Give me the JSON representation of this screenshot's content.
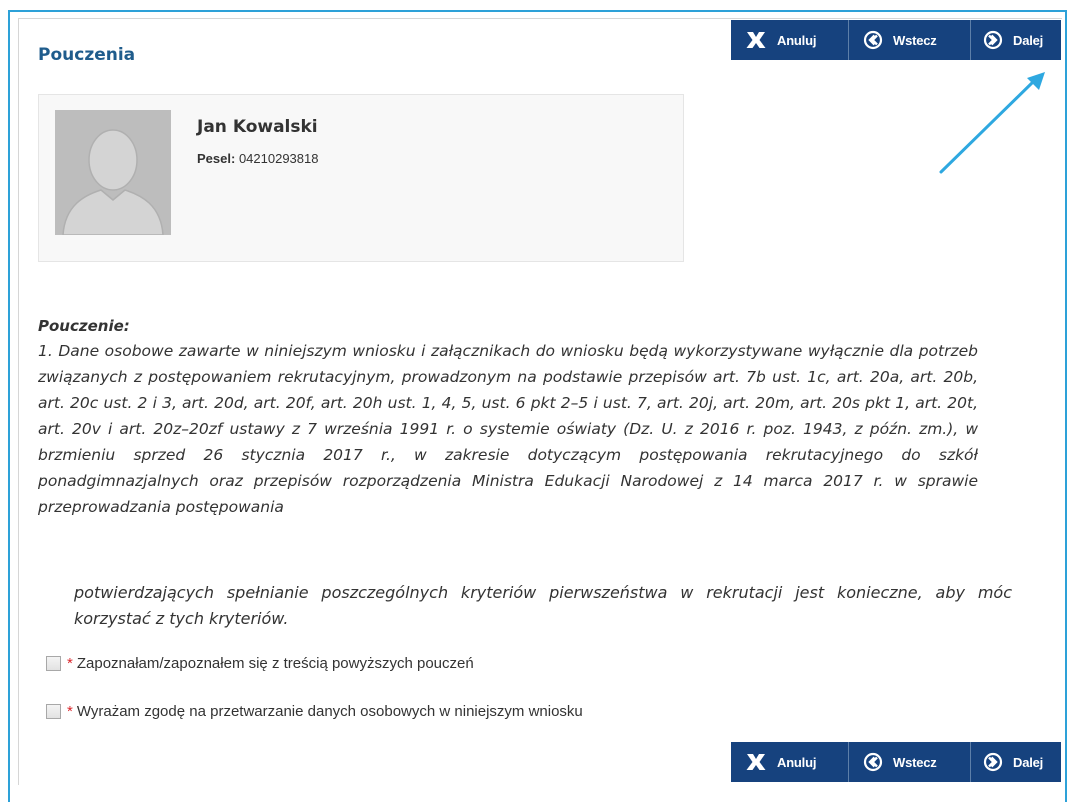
{
  "page": {
    "title": "Pouczenia"
  },
  "buttons": {
    "anuluj": "Anuluj",
    "wstecz": "Wstecz",
    "dalej": "Dalej"
  },
  "profile": {
    "name": "Jan Kowalski",
    "pesel_label": "Pesel:",
    "pesel_value": "04210293818"
  },
  "notice": {
    "heading": "Pouczenie:",
    "body": "1. Dane osobowe zawarte w niniejszym wniosku i załącznikach do wniosku będą wykorzystywane wyłącznie dla potrzeb związanych z postępowaniem rekrutacyjnym, prowadzonym na podstawie przepisów art. 7b ust. 1c, art. 20a, art. 20b, art. 20c ust. 2 i 3, art. 20d, art. 20f, art. 20h ust. 1, 4, 5, ust. 6 pkt 2–5 i ust. 7, art. 20j, art. 20m, art. 20s pkt 1, art. 20t, art. 20v i art. 20z–20zf ustawy z 7 września 1991 r. o systemie oświaty (Dz. U. z 2016 r. poz. 1943, z późn. zm.), w brzmieniu sprzed 26 stycznia 2017 r., w zakresie dotyczącym postępowania rekrutacyjnego do szkół ponadgimnazjalnych oraz przepisów rozporządzenia Ministra Edukacji Narodowej z 14 marca 2017 r. w sprawie przeprowadzania postępowania",
    "tail": "potwierdzających spełnianie poszczególnych kryteriów pierwszeństwa w rekrutacji jest konieczne, aby móc korzystać z tych kryteriów."
  },
  "consents": [
    {
      "required_mark": "*",
      "label": "Zapoznałam/zapoznałem się z treścią powyższych pouczeń",
      "checked": false
    },
    {
      "required_mark": "*",
      "label": "Wyrażam zgodę na przetwarzanie danych osobowych w niniejszym wniosku",
      "checked": false
    }
  ],
  "colors": {
    "button_bg": "#16427e",
    "title": "#1f5c8c",
    "frame_border": "#2da1d8",
    "required": "#d9262b"
  },
  "icons": {
    "anuluj": "x-icon",
    "wstecz": "circle-arrow-left-icon",
    "dalej": "circle-arrow-right-icon",
    "annotation": "pointer-arrow-icon"
  }
}
